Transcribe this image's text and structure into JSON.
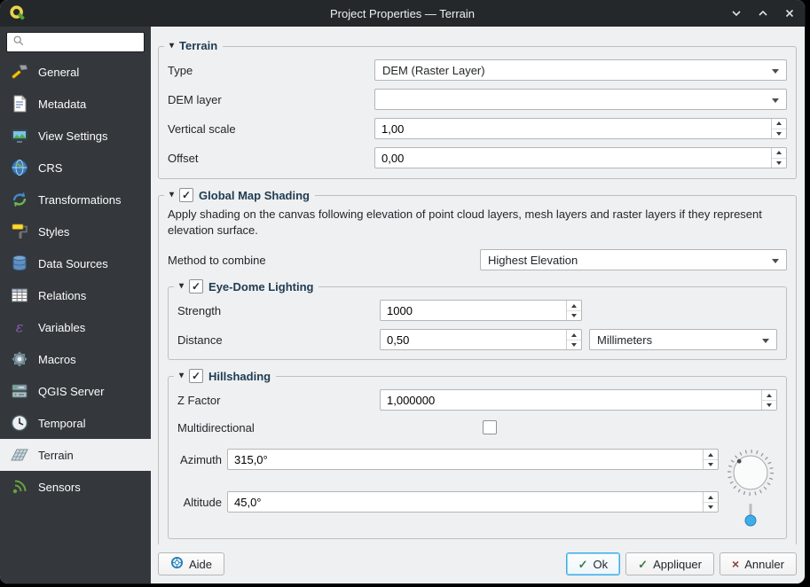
{
  "window": {
    "title": "Project Properties — Terrain"
  },
  "titlebar": {
    "controls": [
      "chevron-down-icon",
      "chevron-up-icon",
      "close-icon"
    ]
  },
  "ui": {
    "check_glyph": "✓",
    "cross_glyph": "×",
    "collapse_glyph": "▾",
    "accent_color": "#3daee9",
    "titlebar_color": "#24282b",
    "sidebar_color": "#34383c"
  },
  "sidebar": {
    "search": {
      "value": "",
      "placeholder": ""
    },
    "items": [
      {
        "label": "General",
        "icon": "general-icon"
      },
      {
        "label": "Metadata",
        "icon": "metadata-icon"
      },
      {
        "label": "View Settings",
        "icon": "view-settings-icon"
      },
      {
        "label": "CRS",
        "icon": "crs-icon"
      },
      {
        "label": "Transformations",
        "icon": "transformations-icon"
      },
      {
        "label": "Styles",
        "icon": "styles-icon"
      },
      {
        "label": "Data Sources",
        "icon": "data-sources-icon"
      },
      {
        "label": "Relations",
        "icon": "relations-icon"
      },
      {
        "label": "Variables",
        "icon": "variables-icon"
      },
      {
        "label": "Macros",
        "icon": "macros-icon"
      },
      {
        "label": "QGIS Server",
        "icon": "qgis-server-icon"
      },
      {
        "label": "Temporal",
        "icon": "temporal-icon"
      },
      {
        "label": "Terrain",
        "icon": "terrain-icon",
        "selected": true
      },
      {
        "label": "Sensors",
        "icon": "sensors-icon"
      }
    ]
  },
  "sections": {
    "terrain": {
      "title": "Terrain",
      "type_label": "Type",
      "type_value": "DEM (Raster Layer)",
      "dem_layer_label": "DEM layer",
      "dem_layer_value": "",
      "vertical_scale_label": "Vertical scale",
      "vertical_scale_value": "1,00",
      "offset_label": "Offset",
      "offset_value": "0,00"
    },
    "shading": {
      "title": "Global Map Shading",
      "checked": true,
      "description": "Apply shading on the canvas following elevation of point cloud layers, mesh layers and raster layers if they represent elevation surface.",
      "method_label": "Method to combine",
      "method_value": "Highest Elevation"
    },
    "eye_dome": {
      "title": "Eye-Dome Lighting",
      "checked": true,
      "strength_label": "Strength",
      "strength_value": "1000",
      "distance_label": "Distance",
      "distance_value": "0,50",
      "distance_unit": "Millimeters"
    },
    "hillshading": {
      "title": "Hillshading",
      "checked": true,
      "z_factor_label": "Z Factor",
      "z_factor_value": "1,000000",
      "multidirectional_label": "Multidirectional",
      "multidirectional_checked": false,
      "azimuth_label": "Azimuth",
      "azimuth_value": "315,0°",
      "altitude_label": "Altitude",
      "altitude_value": "45,0°"
    }
  },
  "footer": {
    "help_label": "Aide",
    "ok_label": "Ok",
    "apply_label": "Appliquer",
    "cancel_label": "Annuler"
  }
}
